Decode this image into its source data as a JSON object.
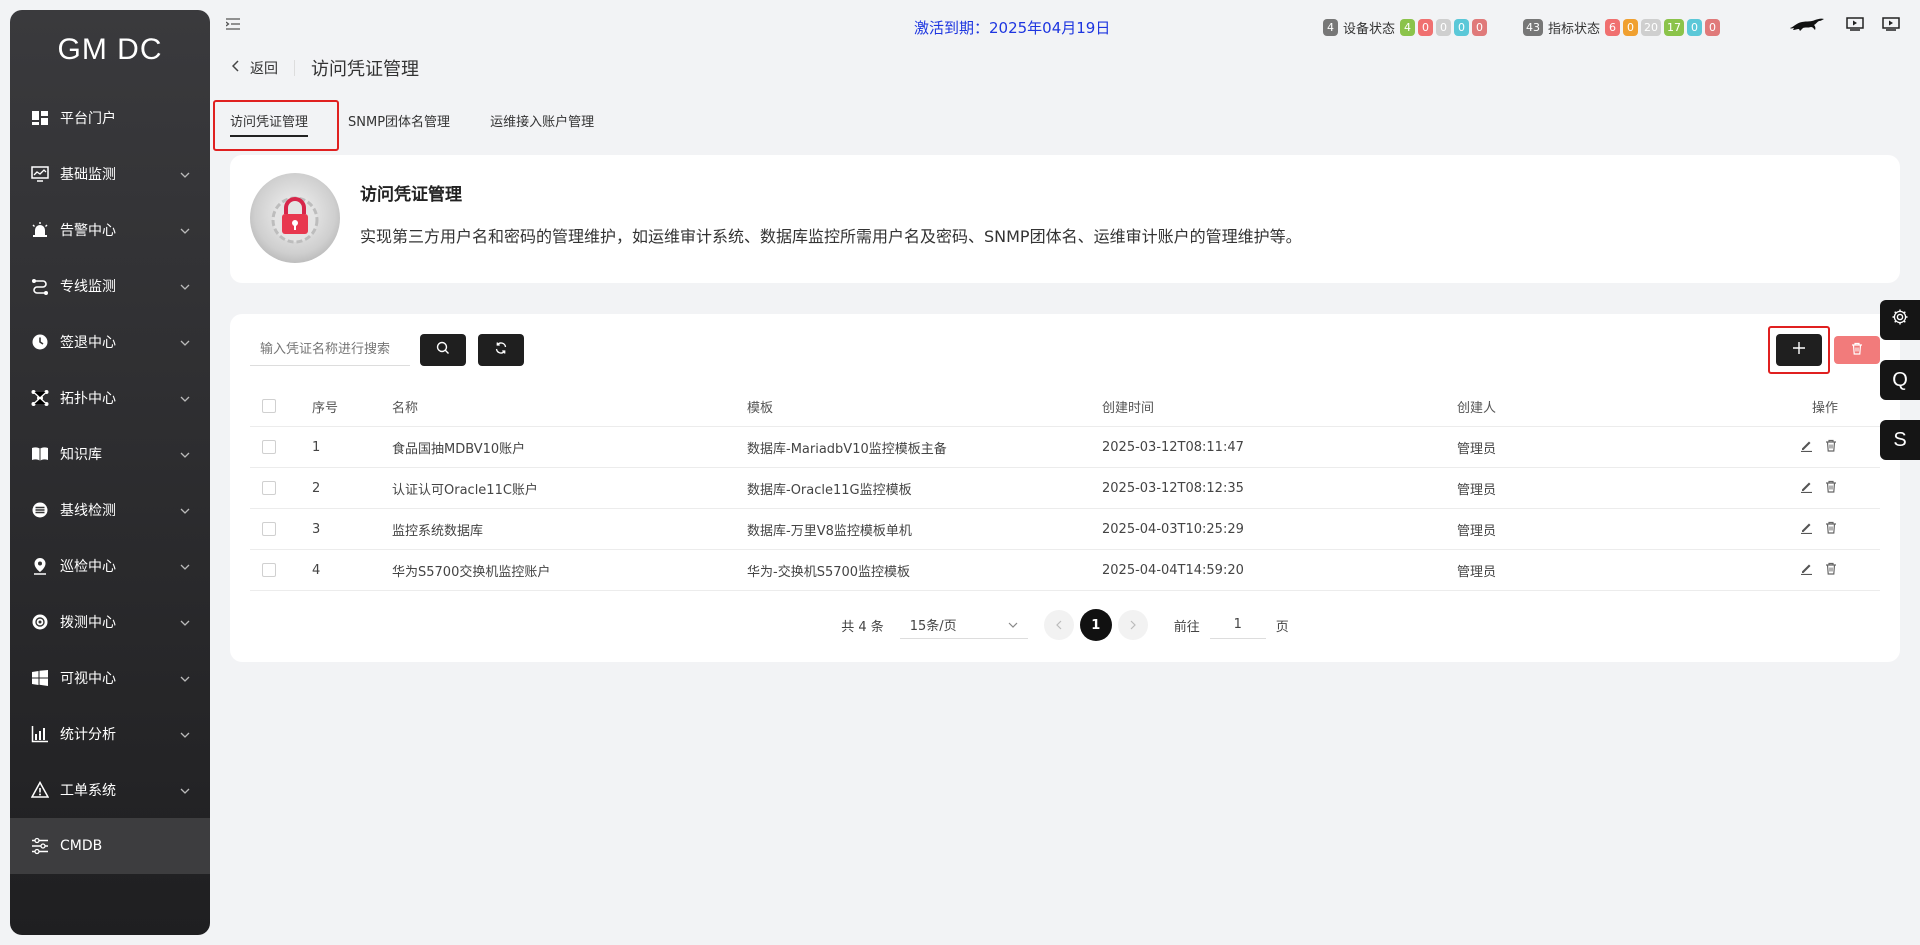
{
  "app": {
    "logo": "GM DC"
  },
  "sidebar": {
    "items": [
      {
        "label": "平台门户",
        "icon": "dashboard-icon",
        "has_children": false
      },
      {
        "label": "基础监测",
        "icon": "monitor-icon",
        "has_children": true
      },
      {
        "label": "告警中心",
        "icon": "alarm-icon",
        "has_children": true
      },
      {
        "label": "专线监测",
        "icon": "route-icon",
        "has_children": true
      },
      {
        "label": "签退中心",
        "icon": "clock-icon",
        "has_children": true
      },
      {
        "label": "拓扑中心",
        "icon": "topology-icon",
        "has_children": true
      },
      {
        "label": "知识库",
        "icon": "book-icon",
        "has_children": true
      },
      {
        "label": "基线检测",
        "icon": "baseline-icon",
        "has_children": true
      },
      {
        "label": "巡检中心",
        "icon": "location-icon",
        "has_children": true
      },
      {
        "label": "拨测中心",
        "icon": "probe-icon",
        "has_children": true
      },
      {
        "label": "可视中心",
        "icon": "windows-icon",
        "has_children": true
      },
      {
        "label": "统计分析",
        "icon": "chart-icon",
        "has_children": true
      },
      {
        "label": "工单系统",
        "icon": "warning-icon",
        "has_children": true
      },
      {
        "label": "CMDB",
        "icon": "sliders-icon",
        "has_children": false,
        "active": true
      }
    ]
  },
  "header": {
    "expire_text": "激活到期：2025年04月19日",
    "device_status": {
      "total": "4",
      "label": "设备状态",
      "counts": [
        "4",
        "0",
        "0",
        "0",
        "0"
      ],
      "colors": [
        "#8bc34a",
        "#f07070",
        "#cfcfcf",
        "#5bc8d8",
        "#e07a7a"
      ]
    },
    "metric_status": {
      "total": "43",
      "label": "指标状态",
      "counts": [
        "6",
        "0",
        "20",
        "17",
        "0",
        "0"
      ],
      "colors": [
        "#f07070",
        "#f0a030",
        "#cfcfcf",
        "#8bc34a",
        "#5bc8d8",
        "#e07a7a"
      ]
    },
    "total_badge_color": "#777777"
  },
  "breadcrumb": {
    "back_label": "返回",
    "title": "访问凭证管理"
  },
  "tabs": [
    "访问凭证管理",
    "SNMP团体名管理",
    "运维接入账户管理"
  ],
  "info": {
    "title": "访问凭证管理",
    "description": "实现第三方用户名和密码的管理维护，如运维审计系统、数据库监控所需用户名及密码、SNMP团体名、运维审计账户的管理维护等。"
  },
  "toolbar": {
    "search_placeholder": "输入凭证名称进行搜索"
  },
  "table": {
    "columns": [
      "序号",
      "名称",
      "模板",
      "创建时间",
      "创建人",
      "操作"
    ],
    "rows": [
      {
        "index": "1",
        "name": "食品国抽MDBV10账户",
        "template": "数据库-MariadbV10监控模板主备",
        "created": "2025-03-12T08:11:47",
        "creator": "管理员"
      },
      {
        "index": "2",
        "name": "认证认可Oracle11C账户",
        "template": "数据库-Oracle11G监控模板",
        "created": "2025-03-12T08:12:35",
        "creator": "管理员"
      },
      {
        "index": "3",
        "name": "监控系统数据库",
        "template": "数据库-万里V8监控模板单机",
        "created": "2025-04-03T10:25:29",
        "creator": "管理员"
      },
      {
        "index": "4",
        "name": "华为S5700交换机监控账户",
        "template": "华为-交换机S5700监控模板",
        "created": "2025-04-04T14:59:20",
        "creator": "管理员"
      }
    ]
  },
  "pagination": {
    "total": "共 4 条",
    "page_size": "15条/页",
    "current": "1",
    "goto_label": "前往",
    "goto_value": "1",
    "page_suffix": "页"
  },
  "float_buttons": [
    "Q",
    "S"
  ]
}
